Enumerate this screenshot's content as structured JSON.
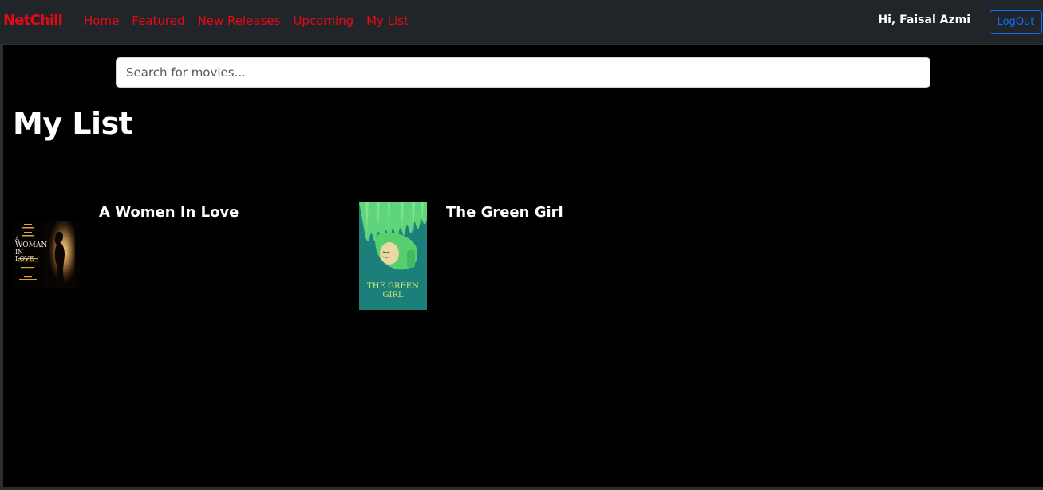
{
  "nav": {
    "brand": "NetChill",
    "links": [
      "Home",
      "Featured",
      "New Releases",
      "Upcoming",
      "My List"
    ],
    "greeting": "Hi, Faisal Azmi",
    "logout_label": "LogOut"
  },
  "search": {
    "placeholder": "Search for movies...",
    "value": ""
  },
  "page": {
    "title": "My List"
  },
  "movies": [
    {
      "title": "A Women In Love",
      "poster": {
        "line1": "A",
        "line2": "WOMAN",
        "line3": "IN LOVE"
      }
    },
    {
      "title": "The Green Girl",
      "poster": {
        "line1": "THE GREEN",
        "line2": "GIRL"
      }
    }
  ],
  "colors": {
    "navbar_bg": "#212529",
    "brand_red": "#e50914",
    "logout_blue": "#0d6efd",
    "page_bg": "#000000",
    "green_poster_bg": "#1d7f7a"
  }
}
